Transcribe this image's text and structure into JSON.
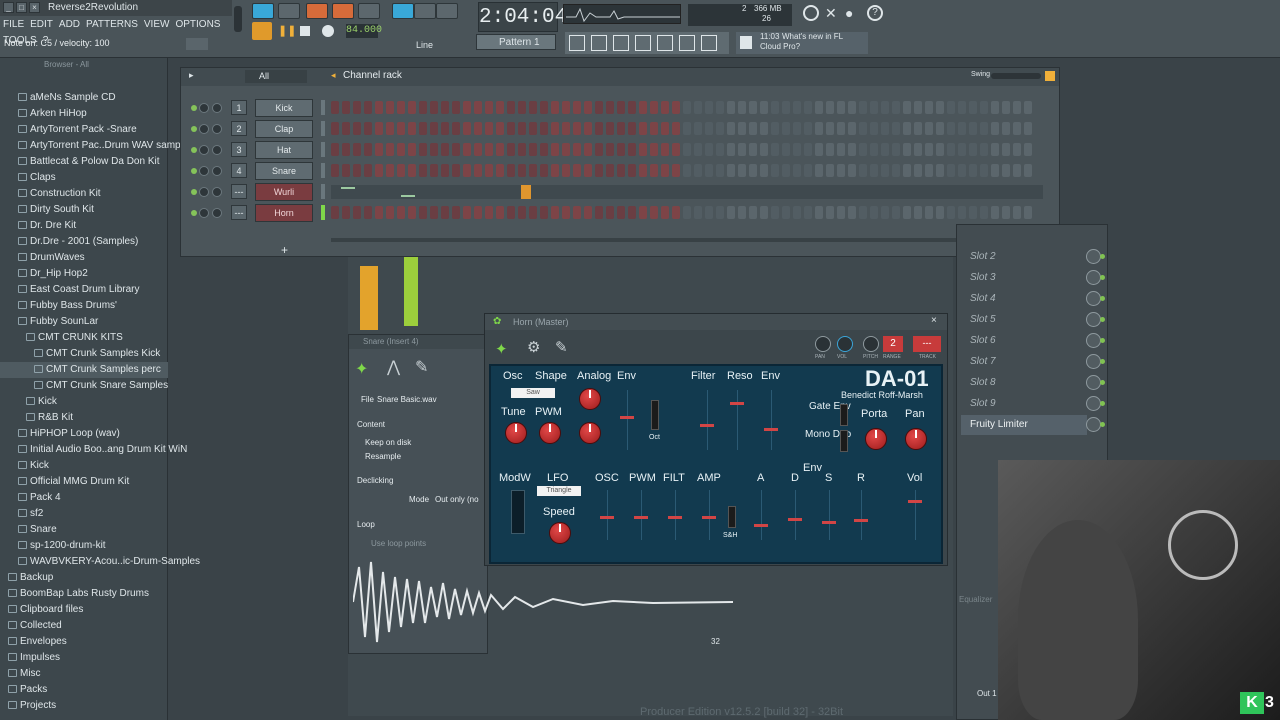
{
  "app": {
    "title": "Reverse2Revolution",
    "hint": "Note on: C5 / velocity: 100"
  },
  "menu": [
    "FILE",
    "EDIT",
    "ADD",
    "PATTERNS",
    "VIEW",
    "OPTIONS",
    "TOOLS",
    "?"
  ],
  "transport": {
    "time": "2:04:04",
    "tempo": "84.000",
    "pattern": "Pattern 1",
    "line_mode": "Line",
    "cpu": "2",
    "mem": "366 MB",
    "voices": "26",
    "news_time": "11:03",
    "news_text": "What's new in FL",
    "news_sub": "Cloud Pro?"
  },
  "browser": {
    "header": "Browser - All",
    "items": [
      "aMeNs Sample CD",
      "Arken HiHop",
      "ArtyTorrent Pack -Snare",
      "ArtyTorrent Pac..Drum WAV samples",
      "Battlecat & Polow Da Don Kit",
      "Claps",
      "Construction Kit",
      "Dirty South Kit",
      "Dr. Dre Kit",
      "Dr.Dre - 2001 (Samples)",
      "DrumWaves",
      "Dr_Hip Hop2",
      "East Coast Drum Library",
      "Fubby  Bass Drums'",
      "Fubby SounLar",
      "CMT CRUNK KITS",
      "CMT Crunk Samples Kick",
      "CMT Crunk Samples perc",
      "CMT Crunk Snare Samples",
      "Kick",
      "R&B Kit",
      "HiPHOP Loop (wav)",
      "Initial Audio Boo..ang Drum Kit WiN",
      "Kick",
      "Official MMG Drum Kit",
      "Pack 4",
      "sf2",
      "Snare",
      "sp-1200-drum-kit",
      "WAVBVKERY-Acou..ic-Drum-Samples",
      "Backup",
      "BoomBap Labs Rusty Drums",
      "Clipboard files",
      "Collected",
      "Envelopes",
      "Impulses",
      "Misc",
      "Packs",
      "Projects"
    ]
  },
  "rack": {
    "title": "Channel rack",
    "filter": "All",
    "swing": "Swing",
    "channels": [
      {
        "num": "1",
        "name": "Kick"
      },
      {
        "num": "2",
        "name": "Clap"
      },
      {
        "num": "3",
        "name": "Hat"
      },
      {
        "num": "4",
        "name": "Snare"
      },
      {
        "num": "---",
        "name": "Wurli"
      },
      {
        "num": "---",
        "name": "Horn"
      }
    ]
  },
  "sampler": {
    "title": "Snare (Insert 4)",
    "file_label": "File",
    "file_value": "Snare Basic.wav",
    "content": "Content",
    "keep": "Keep on disk",
    "resample": "Resample",
    "declick": "Declicking",
    "mode_label": "Mode",
    "mode_value": "Out only (no",
    "loop": "Loop",
    "use_loop": "Use loop points",
    "length": "32"
  },
  "synth": {
    "window_title": "Horn (Master)",
    "brand": "DA-01",
    "author": "Benedict  Roff-Marsh",
    "top_labels": [
      "PAN",
      "VOL",
      "PITCH",
      "RANGE",
      "TRACK"
    ],
    "range_value": "2",
    "osc_labels": [
      "Osc",
      "Shape",
      "Analog",
      "Env"
    ],
    "osc_wave": "Saw",
    "filter_labels": [
      "Filter",
      "Reso",
      "Env"
    ],
    "tune": "Tune",
    "pwm": "PWM",
    "oct": "Oct",
    "gate_env": "Gate Env",
    "mono_duo": "Mono Duo",
    "porta": "Porta",
    "pan": "Pan",
    "modw": "ModW",
    "lfo": "LFO",
    "lfo_wave": "Triangle",
    "speed": "Speed",
    "mod_labels": [
      "OSC",
      "PWM",
      "FILT",
      "AMP"
    ],
    "sh": "S&H",
    "env": "Env",
    "adsr": [
      "A",
      "D",
      "S",
      "R"
    ],
    "vol": "Vol"
  },
  "mixer_slots": [
    "Slot 2",
    "Slot 3",
    "Slot 4",
    "Slot 5",
    "Slot 6",
    "Slot 7",
    "Slot 8",
    "Slot 9",
    "Fruity Limiter"
  ],
  "mixer_extra": {
    "equalizer": "Equalizer",
    "out": "Out 1"
  },
  "footer": "Producer Edition v12.5.2 [build 32] - 32Bit",
  "channel_name": "3"
}
